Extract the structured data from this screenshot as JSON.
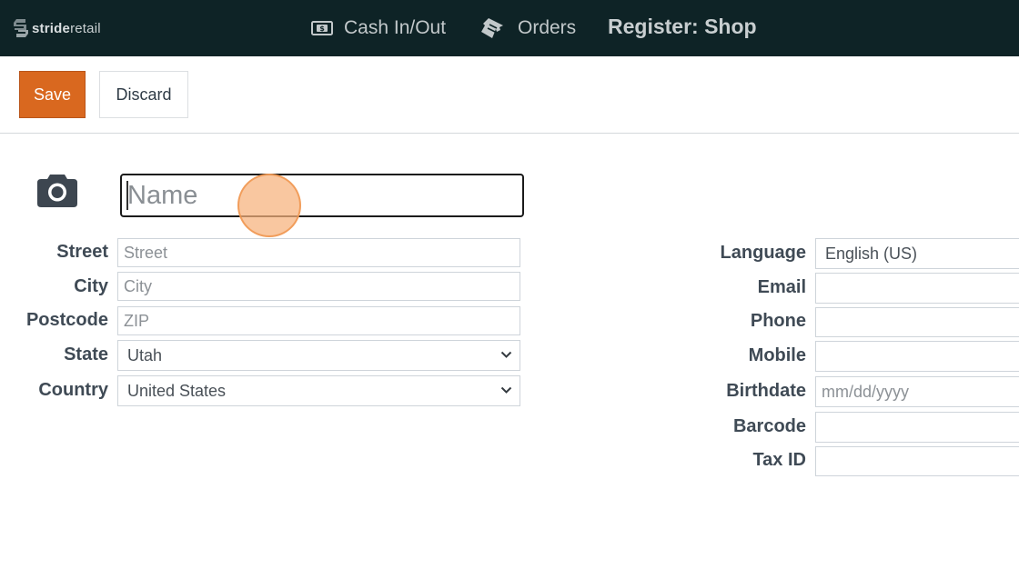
{
  "brand": {
    "name_part1": "stride",
    "name_part2": "retail"
  },
  "nav": {
    "cash": {
      "label": "Cash In/Out",
      "icon": "money-icon"
    },
    "orders": {
      "label": "Orders",
      "icon": "ticket-icon"
    },
    "register": "Register: Shop"
  },
  "toolbar": {
    "save_label": "Save",
    "discard_label": "Discard"
  },
  "form": {
    "name_placeholder": "Name",
    "street": {
      "label": "Street",
      "placeholder": "Street"
    },
    "city": {
      "label": "City",
      "placeholder": "City"
    },
    "postcode": {
      "label": "Postcode",
      "placeholder": "ZIP"
    },
    "state": {
      "label": "State",
      "value": "Utah"
    },
    "country": {
      "label": "Country",
      "value": "United States"
    },
    "language": {
      "label": "Language",
      "value": "English (US)"
    },
    "email": {
      "label": "Email"
    },
    "phone": {
      "label": "Phone"
    },
    "mobile": {
      "label": "Mobile"
    },
    "birthdate": {
      "label": "Birthdate",
      "placeholder": "mm/dd/yyyy"
    },
    "barcode": {
      "label": "Barcode"
    },
    "tax_id": {
      "label": "Tax ID"
    }
  },
  "colors": {
    "topbar": "#0e2326",
    "accent": "#d9681f"
  }
}
